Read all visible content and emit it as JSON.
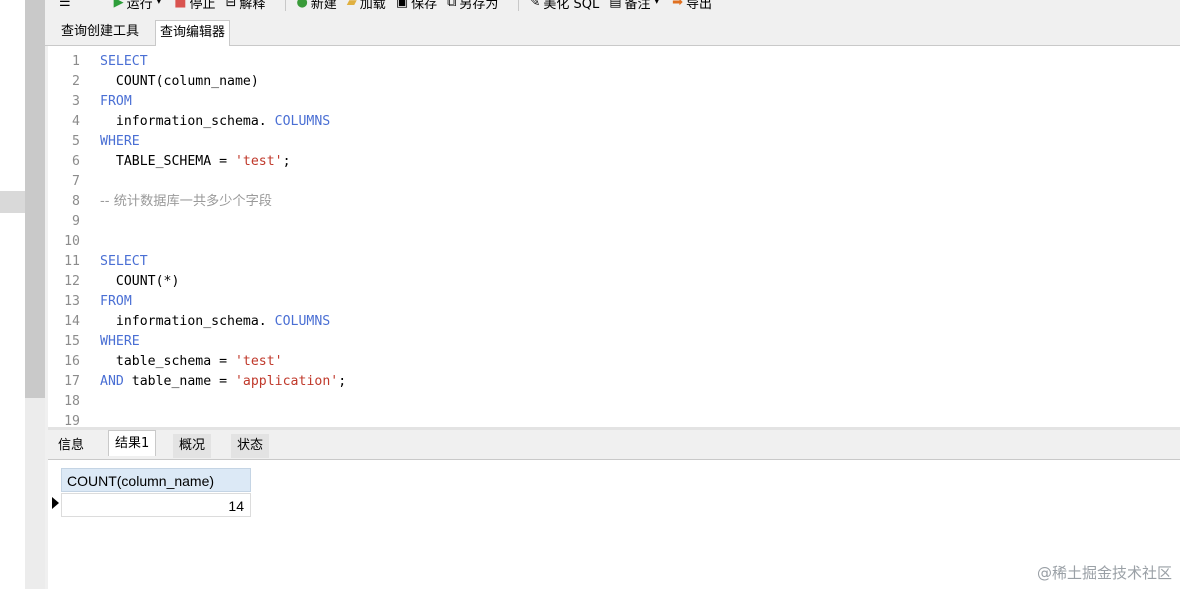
{
  "toolbar": {
    "run_label": "运行",
    "stop_label": "停止",
    "explain_label": "解释",
    "new_label": "新建",
    "load_label": "加载",
    "save_label": "保存",
    "save_as_label": "另存为",
    "beautify_label": "美化 SQL",
    "note_label": "备注",
    "export_label": "导出"
  },
  "tabs": [
    {
      "label": "查询创建工具"
    },
    {
      "label": "查询编辑器"
    }
  ],
  "editor": {
    "lines": [
      {
        "num": "1",
        "segments": [
          {
            "t": "SELECT",
            "c": "kw"
          }
        ]
      },
      {
        "num": "2",
        "segments": [
          {
            "t": "  COUNT(column_name)",
            "c": "plain"
          }
        ]
      },
      {
        "num": "3",
        "segments": [
          {
            "t": "FROM",
            "c": "kw"
          }
        ]
      },
      {
        "num": "4",
        "segments": [
          {
            "t": "  information_schema. ",
            "c": "plain"
          },
          {
            "t": "COLUMNS",
            "c": "kw"
          }
        ]
      },
      {
        "num": "5",
        "segments": [
          {
            "t": "WHERE",
            "c": "kw"
          }
        ]
      },
      {
        "num": "6",
        "segments": [
          {
            "t": "  TABLE_SCHEMA = ",
            "c": "plain"
          },
          {
            "t": "'test'",
            "c": "str"
          },
          {
            "t": ";",
            "c": "plain"
          }
        ]
      },
      {
        "num": "7",
        "segments": []
      },
      {
        "num": "8",
        "segments": [
          {
            "t": "-- 统计数据库一共多少个字段",
            "c": "cmt"
          }
        ]
      },
      {
        "num": "9",
        "segments": []
      },
      {
        "num": "10",
        "segments": []
      },
      {
        "num": "11",
        "segments": [
          {
            "t": "SELECT",
            "c": "kw"
          }
        ]
      },
      {
        "num": "12",
        "segments": [
          {
            "t": "  COUNT(*)",
            "c": "plain"
          }
        ]
      },
      {
        "num": "13",
        "segments": [
          {
            "t": "FROM",
            "c": "kw"
          }
        ]
      },
      {
        "num": "14",
        "segments": [
          {
            "t": "  information_schema. ",
            "c": "plain"
          },
          {
            "t": "COLUMNS",
            "c": "kw"
          }
        ]
      },
      {
        "num": "15",
        "segments": [
          {
            "t": "WHERE",
            "c": "kw"
          }
        ]
      },
      {
        "num": "16",
        "segments": [
          {
            "t": "  table_schema = ",
            "c": "plain"
          },
          {
            "t": "'test'",
            "c": "str"
          }
        ]
      },
      {
        "num": "17",
        "segments": [
          {
            "t": "AND",
            "c": "kw"
          },
          {
            "t": " table_name = ",
            "c": "plain"
          },
          {
            "t": "'application'",
            "c": "str"
          },
          {
            "t": ";",
            "c": "plain"
          }
        ]
      },
      {
        "num": "18",
        "segments": []
      },
      {
        "num": "19",
        "segments": []
      }
    ]
  },
  "result_tabs": [
    {
      "label": "信息"
    },
    {
      "label": "结果1"
    },
    {
      "label": "概况"
    },
    {
      "label": "状态"
    }
  ],
  "results": {
    "column_header": "COUNT(column_name)",
    "value": "14"
  },
  "watermark": "@稀土掘金技术社区",
  "colors": {
    "keyword": "#4a6fd4",
    "string": "#c0392b",
    "comment": "#9a9a9a",
    "grid_header": "#dce9f6"
  }
}
